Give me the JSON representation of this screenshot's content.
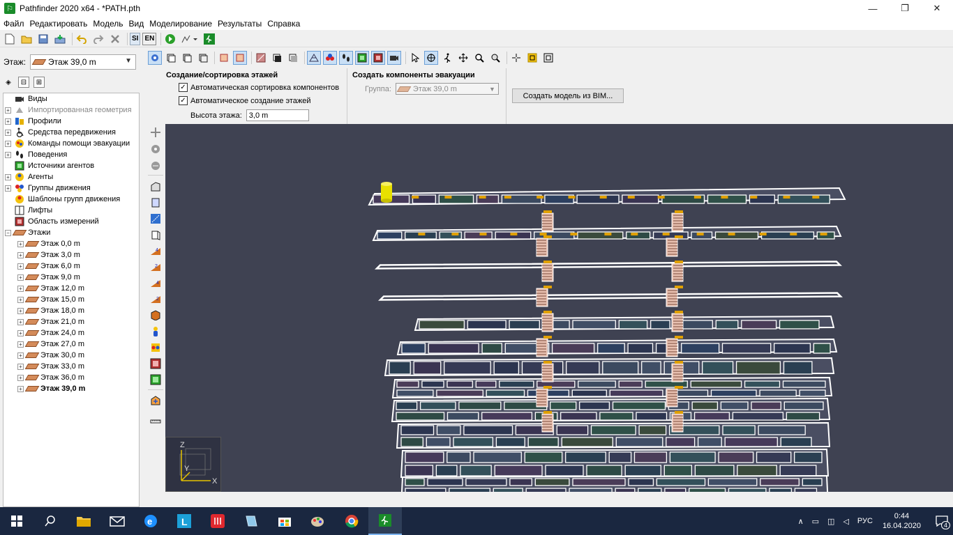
{
  "window": {
    "title": "Pathfinder 2020 x64 - *PATH.pth",
    "minimize": "—",
    "maximize": "❐",
    "close": "✕"
  },
  "menu": [
    "Файл",
    "Редактировать",
    "Модель",
    "Вид",
    "Моделирование",
    "Результаты",
    "Справка"
  ],
  "toolbar": {
    "si_label": "SI",
    "en_label": "EN"
  },
  "left_panel": {
    "floor_label": "Этаж:",
    "floor_selected": "Этаж 39,0 m",
    "tree": [
      {
        "label": "Виды",
        "icon": "camera-icon",
        "expand": false
      },
      {
        "label": "Импортированная геометрия",
        "icon": "geometry-icon",
        "expand": true,
        "gray": true
      },
      {
        "label": "Профили",
        "icon": "profiles-icon",
        "expand": true
      },
      {
        "label": "Средства передвижения",
        "icon": "wheelchair-icon",
        "expand": true
      },
      {
        "label": "Команды помощи эвакуации",
        "icon": "assist-team-icon",
        "expand": true
      },
      {
        "label": "Поведения",
        "icon": "footsteps-icon",
        "expand": true
      },
      {
        "label": "Источники агентов",
        "icon": "agent-source-icon",
        "expand": false
      },
      {
        "label": "Агенты",
        "icon": "agents-icon",
        "expand": true
      },
      {
        "label": "Группы движения",
        "icon": "movement-groups-icon",
        "expand": true
      },
      {
        "label": "Шаблоны групп движения",
        "icon": "group-templates-icon",
        "expand": false
      },
      {
        "label": "Лифты",
        "icon": "elevator-icon",
        "expand": false
      },
      {
        "label": "Область измерений",
        "icon": "measurement-region-icon",
        "expand": false
      },
      {
        "label": "Этажи",
        "icon": "floors-icon",
        "expand": true,
        "open": true
      }
    ],
    "floors": [
      "Этаж 0,0 m",
      "Этаж 3,0 m",
      "Этаж 6,0 m",
      "Этаж 9,0 m",
      "Этаж 12,0 m",
      "Этаж 15,0 m",
      "Этаж 18,0 m",
      "Этаж 21,0 m",
      "Этаж 24,0 m",
      "Этаж 27,0 m",
      "Этаж 30,0 m",
      "Этаж 33,0 m",
      "Этаж 36,0 m",
      "Этаж 39,0 m"
    ],
    "floor_bold_index": 13
  },
  "options": {
    "floors_title": "Создание/сортировка этажей",
    "auto_sort_label": "Автоматическая сортировка компонентов",
    "auto_sort_checked": true,
    "auto_create_label": "Автоматическое создание этажей",
    "auto_create_checked": true,
    "floor_height_label": "Высота этажа:",
    "floor_height_value": "3,0 m",
    "evac_title": "Создать компоненты эвакуации",
    "group_label": "Группа:",
    "group_value": "Этаж 39,0 m",
    "bim_button": "Создать модель из BIM..."
  },
  "viewport": {
    "background": "#3f4252",
    "axis_z": "Z",
    "axis_y": "Y",
    "axis_x": "X"
  },
  "taskbar": {
    "language": "РУС",
    "time": "0:44",
    "date": "16.04.2020",
    "notifications": "4"
  }
}
